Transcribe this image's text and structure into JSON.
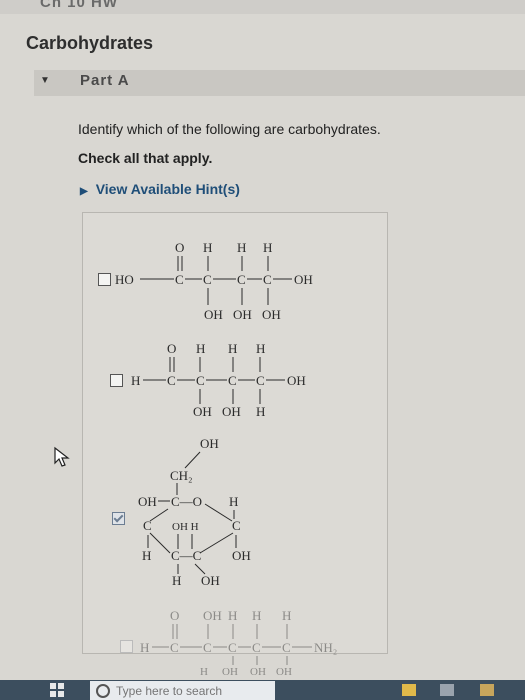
{
  "window": {
    "top_text": "Ch 10 HW"
  },
  "page": {
    "title": "Carbohydrates"
  },
  "part": {
    "label": "Part A"
  },
  "question": {
    "prompt": "Identify which of the following are carbohydrates.",
    "instruction": "Check all that apply.",
    "hint_label": "View Available Hint(s)"
  },
  "options": [
    {
      "checked": false,
      "labels": {
        "top": [
          "O",
          "H",
          "H",
          "H"
        ],
        "left": "HO",
        "right": "OH",
        "bottom": [
          "OH",
          "OH",
          "OH"
        ]
      }
    },
    {
      "checked": false,
      "labels": {
        "top": [
          "O",
          "H",
          "H",
          "H"
        ],
        "left": "H",
        "right": "OH",
        "bottom": [
          "OH",
          "OH",
          "H"
        ]
      }
    },
    {
      "checked": true,
      "labels": {
        "oh_top": "OH",
        "ch2": "CH₂",
        "oh_left": "OH",
        "c_o": "C—O",
        "h_ur": "H",
        "c_left": "C",
        "oh_h_mid": "OH H",
        "c_right": "C",
        "h_ll": "H",
        "c_c": "C—C",
        "oh_lr": "OH",
        "h_bottom": "H",
        "oh_bottom": "OH"
      }
    },
    {
      "checked": false,
      "labels": {
        "top": [
          "O",
          "OH",
          "H",
          "H",
          "H"
        ],
        "left": "H",
        "right": "NH₂",
        "bottom": [
          "H",
          "OH",
          "OH",
          "OH"
        ]
      }
    }
  ],
  "taskbar": {
    "search_placeholder": "Type here to search"
  },
  "colors": {
    "hint_link": "#1f4e78",
    "taskbar": "#3c4e5e"
  }
}
